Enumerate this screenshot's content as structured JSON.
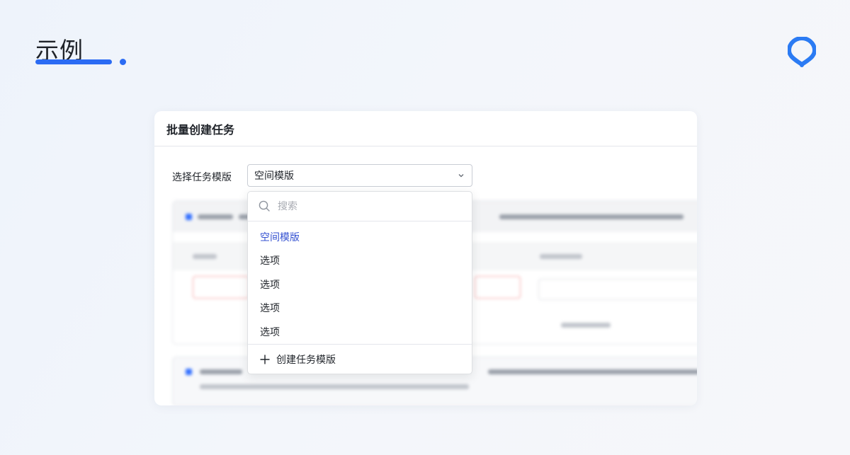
{
  "header": {
    "title": "示例",
    "accent_color": "#2b6bf3"
  },
  "logo": {
    "icon": "pin-logo-icon"
  },
  "dialog": {
    "title": "批量创建任务",
    "template_field": {
      "label": "选择任务模版",
      "value": "空间模版"
    }
  },
  "dropdown": {
    "search_placeholder": "搜索",
    "options": [
      {
        "label": "空间模版",
        "selected": true
      },
      {
        "label": "选项",
        "selected": false
      },
      {
        "label": "选项",
        "selected": false
      },
      {
        "label": "选项",
        "selected": false
      },
      {
        "label": "选项",
        "selected": false
      }
    ],
    "footer_label": "创建任务模版",
    "selected_color": "#3451d1"
  }
}
